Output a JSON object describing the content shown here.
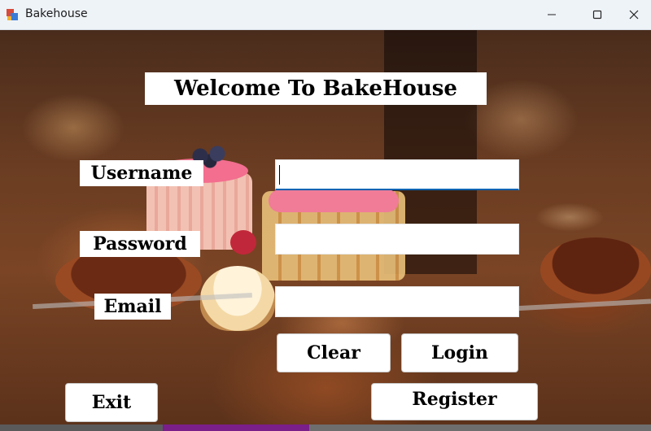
{
  "window": {
    "title": "Bakehouse",
    "icons": [
      "app-icon",
      "minimize-icon",
      "maximize-icon",
      "close-icon"
    ]
  },
  "form": {
    "heading": "Welcome To BakeHouse",
    "username_label": "Username",
    "password_label": "Password",
    "email_label": "Email",
    "username_value": "",
    "password_value": "",
    "email_value": "",
    "buttons": {
      "clear": "Clear",
      "login": "Login",
      "exit": "Exit",
      "register": "Register"
    }
  },
  "colors": {
    "titlebar": "#eef3f8",
    "focus_underline": "#0063b1",
    "label_bg": "#ffffff"
  }
}
